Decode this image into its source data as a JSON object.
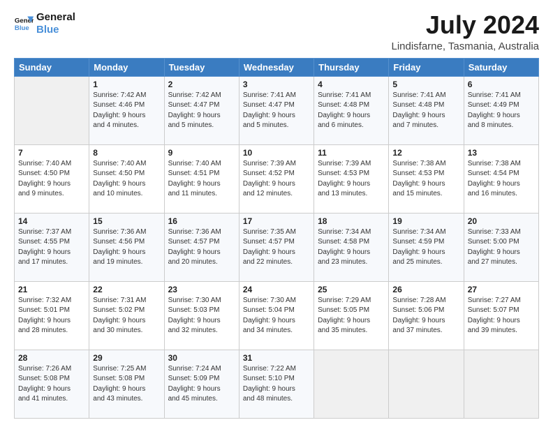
{
  "logo": {
    "line1": "General",
    "line2": "Blue"
  },
  "title": "July 2024",
  "subtitle": "Lindisfarne, Tasmania, Australia",
  "header_days": [
    "Sunday",
    "Monday",
    "Tuesday",
    "Wednesday",
    "Thursday",
    "Friday",
    "Saturday"
  ],
  "weeks": [
    [
      {
        "day": "",
        "info": ""
      },
      {
        "day": "1",
        "info": "Sunrise: 7:42 AM\nSunset: 4:46 PM\nDaylight: 9 hours\nand 4 minutes."
      },
      {
        "day": "2",
        "info": "Sunrise: 7:42 AM\nSunset: 4:47 PM\nDaylight: 9 hours\nand 5 minutes."
      },
      {
        "day": "3",
        "info": "Sunrise: 7:41 AM\nSunset: 4:47 PM\nDaylight: 9 hours\nand 5 minutes."
      },
      {
        "day": "4",
        "info": "Sunrise: 7:41 AM\nSunset: 4:48 PM\nDaylight: 9 hours\nand 6 minutes."
      },
      {
        "day": "5",
        "info": "Sunrise: 7:41 AM\nSunset: 4:48 PM\nDaylight: 9 hours\nand 7 minutes."
      },
      {
        "day": "6",
        "info": "Sunrise: 7:41 AM\nSunset: 4:49 PM\nDaylight: 9 hours\nand 8 minutes."
      }
    ],
    [
      {
        "day": "7",
        "info": "Sunrise: 7:40 AM\nSunset: 4:50 PM\nDaylight: 9 hours\nand 9 minutes."
      },
      {
        "day": "8",
        "info": "Sunrise: 7:40 AM\nSunset: 4:50 PM\nDaylight: 9 hours\nand 10 minutes."
      },
      {
        "day": "9",
        "info": "Sunrise: 7:40 AM\nSunset: 4:51 PM\nDaylight: 9 hours\nand 11 minutes."
      },
      {
        "day": "10",
        "info": "Sunrise: 7:39 AM\nSunset: 4:52 PM\nDaylight: 9 hours\nand 12 minutes."
      },
      {
        "day": "11",
        "info": "Sunrise: 7:39 AM\nSunset: 4:53 PM\nDaylight: 9 hours\nand 13 minutes."
      },
      {
        "day": "12",
        "info": "Sunrise: 7:38 AM\nSunset: 4:53 PM\nDaylight: 9 hours\nand 15 minutes."
      },
      {
        "day": "13",
        "info": "Sunrise: 7:38 AM\nSunset: 4:54 PM\nDaylight: 9 hours\nand 16 minutes."
      }
    ],
    [
      {
        "day": "14",
        "info": "Sunrise: 7:37 AM\nSunset: 4:55 PM\nDaylight: 9 hours\nand 17 minutes."
      },
      {
        "day": "15",
        "info": "Sunrise: 7:36 AM\nSunset: 4:56 PM\nDaylight: 9 hours\nand 19 minutes."
      },
      {
        "day": "16",
        "info": "Sunrise: 7:36 AM\nSunset: 4:57 PM\nDaylight: 9 hours\nand 20 minutes."
      },
      {
        "day": "17",
        "info": "Sunrise: 7:35 AM\nSunset: 4:57 PM\nDaylight: 9 hours\nand 22 minutes."
      },
      {
        "day": "18",
        "info": "Sunrise: 7:34 AM\nSunset: 4:58 PM\nDaylight: 9 hours\nand 23 minutes."
      },
      {
        "day": "19",
        "info": "Sunrise: 7:34 AM\nSunset: 4:59 PM\nDaylight: 9 hours\nand 25 minutes."
      },
      {
        "day": "20",
        "info": "Sunrise: 7:33 AM\nSunset: 5:00 PM\nDaylight: 9 hours\nand 27 minutes."
      }
    ],
    [
      {
        "day": "21",
        "info": "Sunrise: 7:32 AM\nSunset: 5:01 PM\nDaylight: 9 hours\nand 28 minutes."
      },
      {
        "day": "22",
        "info": "Sunrise: 7:31 AM\nSunset: 5:02 PM\nDaylight: 9 hours\nand 30 minutes."
      },
      {
        "day": "23",
        "info": "Sunrise: 7:30 AM\nSunset: 5:03 PM\nDaylight: 9 hours\nand 32 minutes."
      },
      {
        "day": "24",
        "info": "Sunrise: 7:30 AM\nSunset: 5:04 PM\nDaylight: 9 hours\nand 34 minutes."
      },
      {
        "day": "25",
        "info": "Sunrise: 7:29 AM\nSunset: 5:05 PM\nDaylight: 9 hours\nand 35 minutes."
      },
      {
        "day": "26",
        "info": "Sunrise: 7:28 AM\nSunset: 5:06 PM\nDaylight: 9 hours\nand 37 minutes."
      },
      {
        "day": "27",
        "info": "Sunrise: 7:27 AM\nSunset: 5:07 PM\nDaylight: 9 hours\nand 39 minutes."
      }
    ],
    [
      {
        "day": "28",
        "info": "Sunrise: 7:26 AM\nSunset: 5:08 PM\nDaylight: 9 hours\nand 41 minutes."
      },
      {
        "day": "29",
        "info": "Sunrise: 7:25 AM\nSunset: 5:08 PM\nDaylight: 9 hours\nand 43 minutes."
      },
      {
        "day": "30",
        "info": "Sunrise: 7:24 AM\nSunset: 5:09 PM\nDaylight: 9 hours\nand 45 minutes."
      },
      {
        "day": "31",
        "info": "Sunrise: 7:22 AM\nSunset: 5:10 PM\nDaylight: 9 hours\nand 48 minutes."
      },
      {
        "day": "",
        "info": ""
      },
      {
        "day": "",
        "info": ""
      },
      {
        "day": "",
        "info": ""
      }
    ]
  ]
}
